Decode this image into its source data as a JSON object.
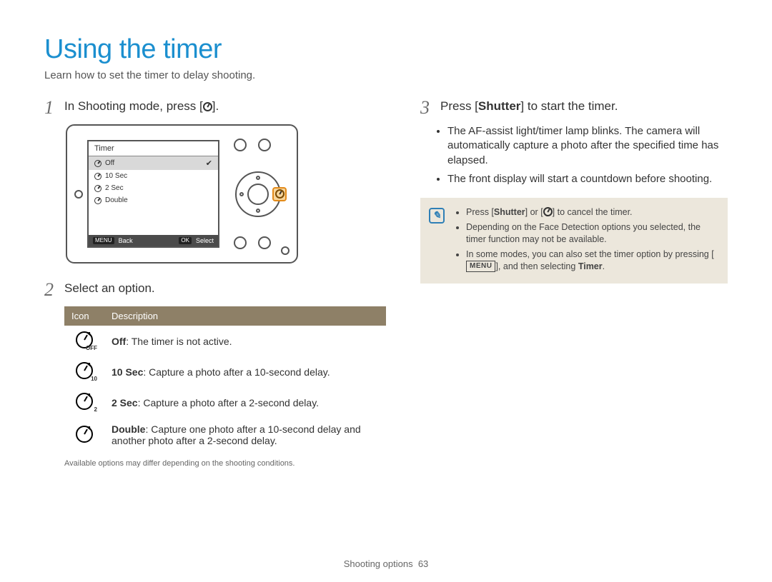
{
  "title": "Using the timer",
  "subtitle": "Learn how to set the timer to delay shooting.",
  "steps": {
    "s1": {
      "num": "1",
      "pre": "In Shooting mode, press [",
      "post": "]."
    },
    "s2": {
      "num": "2",
      "text": "Select an option."
    },
    "s3": {
      "num": "3",
      "pre": "Press [",
      "bold": "Shutter",
      "post": "] to start the timer."
    }
  },
  "camera_menu": {
    "title": "Timer",
    "rows": [
      {
        "label": "Off",
        "selected": true
      },
      {
        "label": "10 Sec",
        "selected": false
      },
      {
        "label": "2 Sec",
        "selected": false
      },
      {
        "label": "Double",
        "selected": false
      }
    ],
    "footer": {
      "back_badge": "MENU",
      "back": "Back",
      "select_badge": "OK",
      "select": "Select"
    }
  },
  "table": {
    "head_icon": "Icon",
    "head_desc": "Description",
    "rows": [
      {
        "icon_sub": "OFF",
        "bold": "Off",
        "text": ": The timer is not active."
      },
      {
        "icon_sub": "10",
        "bold": "10 Sec",
        "text": ": Capture a photo after a 10-second delay."
      },
      {
        "icon_sub": "2",
        "bold": "2 Sec",
        "text": ": Capture a photo after a 2-second delay."
      },
      {
        "icon_sub": "",
        "bold": "Double",
        "text": ": Capture one photo after a 10-second delay and another photo after a 2-second delay."
      }
    ],
    "footnote": "Available options may differ depending on the shooting conditions."
  },
  "bullets": [
    "The AF-assist light/timer lamp blinks. The camera will automatically capture a photo after the specified time has elapsed.",
    "The front display will start a countdown before shooting."
  ],
  "infobox": {
    "items": [
      {
        "pre": "Press [",
        "bold1": "Shutter",
        "mid": "] or [",
        "icon": true,
        "post": "] to cancel the timer."
      },
      {
        "text": "Depending on the Face Detection options you selected, the timer function may not be available."
      },
      {
        "pre": "In some modes, you can also set the timer option by pressing [",
        "menu": "MENU",
        "mid": "], and then selecting ",
        "bold1": "Timer",
        "post": "."
      }
    ]
  },
  "footer": {
    "section": "Shooting options",
    "page": "63"
  }
}
